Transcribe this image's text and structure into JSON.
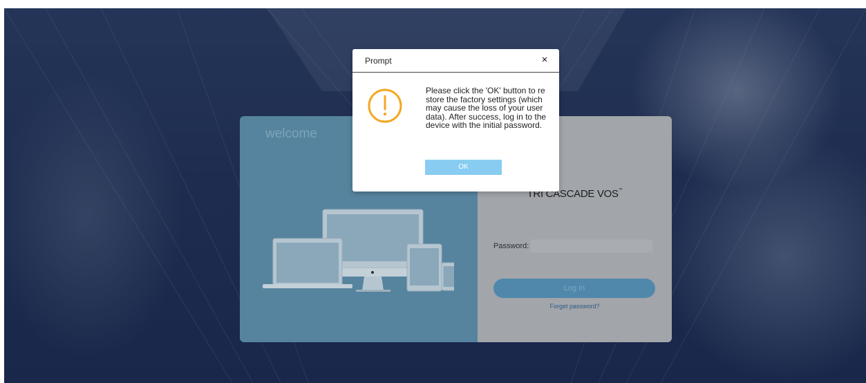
{
  "login_panel": {
    "welcome_text": "welcome",
    "brand_name": "TRI CASCADE VOS",
    "brand_mark": "™",
    "password_label": "Password:",
    "password_value": "",
    "login_button_label": "Log In",
    "forget_password_link": "Forget password?"
  },
  "dialog": {
    "title": "Prompt",
    "close_glyph": "×",
    "icon": "warning-icon",
    "message": "Please click the 'OK' button to restore the factory settings (which may cause the loss of your user data). After success, log in to the device with the initial password.",
    "ok_label": "OK"
  },
  "colors": {
    "dialog_icon_orange": "#f5a623",
    "ok_button": "#88cdf1",
    "login_left_panel": "#56849e",
    "login_right_panel": "#a2a5a9"
  }
}
